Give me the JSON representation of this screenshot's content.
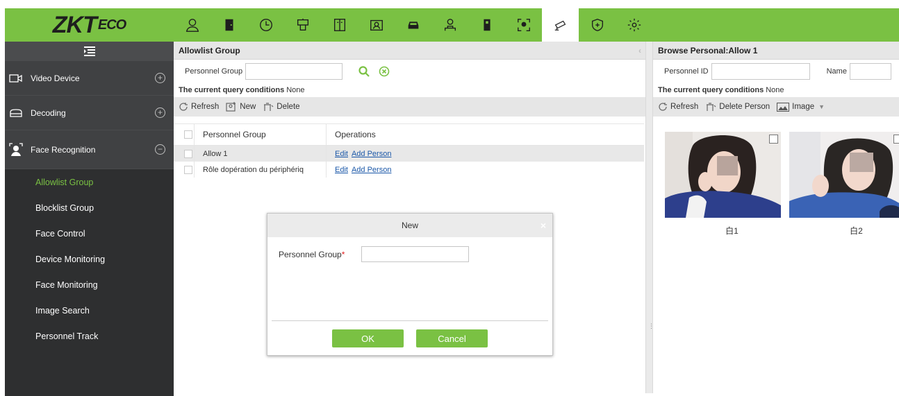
{
  "app": {
    "logo_main": "ZKT",
    "logo_sub": "ECO"
  },
  "topnav": {
    "icons": [
      "personnel-icon",
      "door-icon",
      "attendance-clock-icon",
      "elevator-icon",
      "access-panel-icon",
      "visitor-icon",
      "parking-car-icon",
      "patrol-icon",
      "elevator-control-icon",
      "entrance-icon",
      "video-camera-icon",
      "security-shield-icon",
      "settings-icon"
    ],
    "active_index": 10
  },
  "sidebar": {
    "sections": [
      {
        "label": "Video Device",
        "icon": "video-device-icon",
        "expanded": false
      },
      {
        "label": "Decoding",
        "icon": "decoding-icon",
        "expanded": false
      },
      {
        "label": "Face Recognition",
        "icon": "face-recognition-icon",
        "expanded": true
      }
    ],
    "items": [
      {
        "label": "Allowlist Group",
        "active": true
      },
      {
        "label": "Blocklist Group",
        "active": false
      },
      {
        "label": "Face Control",
        "active": false
      },
      {
        "label": "Device Monitoring",
        "active": false
      },
      {
        "label": "Face Monitoring",
        "active": false
      },
      {
        "label": "Image Search",
        "active": false
      },
      {
        "label": "Personnel Track",
        "active": false
      }
    ]
  },
  "mid": {
    "title": "Allowlist Group",
    "query_label": "Personnel Group",
    "query_value": "",
    "cond_label": "The current query conditions",
    "cond_value": "None",
    "toolbar": {
      "refresh": "Refresh",
      "new": "New",
      "delete": "Delete"
    },
    "grid": {
      "headers": [
        "Personnel Group",
        "Operations"
      ],
      "rows": [
        {
          "group": "Allow 1",
          "edit": "Edit",
          "add": "Add Person",
          "selected": true
        },
        {
          "group": "Rôle dopération du périphériq",
          "edit": "Edit",
          "add": "Add Person",
          "selected": false
        }
      ]
    }
  },
  "right": {
    "title": "Browse Personal:Allow 1",
    "personnel_id_label": "Personnel ID",
    "name_label": "Name",
    "cond_label": "The current query conditions",
    "cond_value": "None",
    "toolbar": {
      "refresh": "Refresh",
      "delete_person": "Delete Person",
      "image": "Image"
    },
    "photos": [
      {
        "name": "白1"
      },
      {
        "name": "白2"
      }
    ]
  },
  "modal": {
    "title": "New",
    "field_label": "Personnel Group",
    "required_mark": "*",
    "field_value": "",
    "ok": "OK",
    "cancel": "Cancel"
  },
  "colors": {
    "accent": "#7ac143",
    "sidebar": "#404143",
    "link": "#1a57a8"
  }
}
